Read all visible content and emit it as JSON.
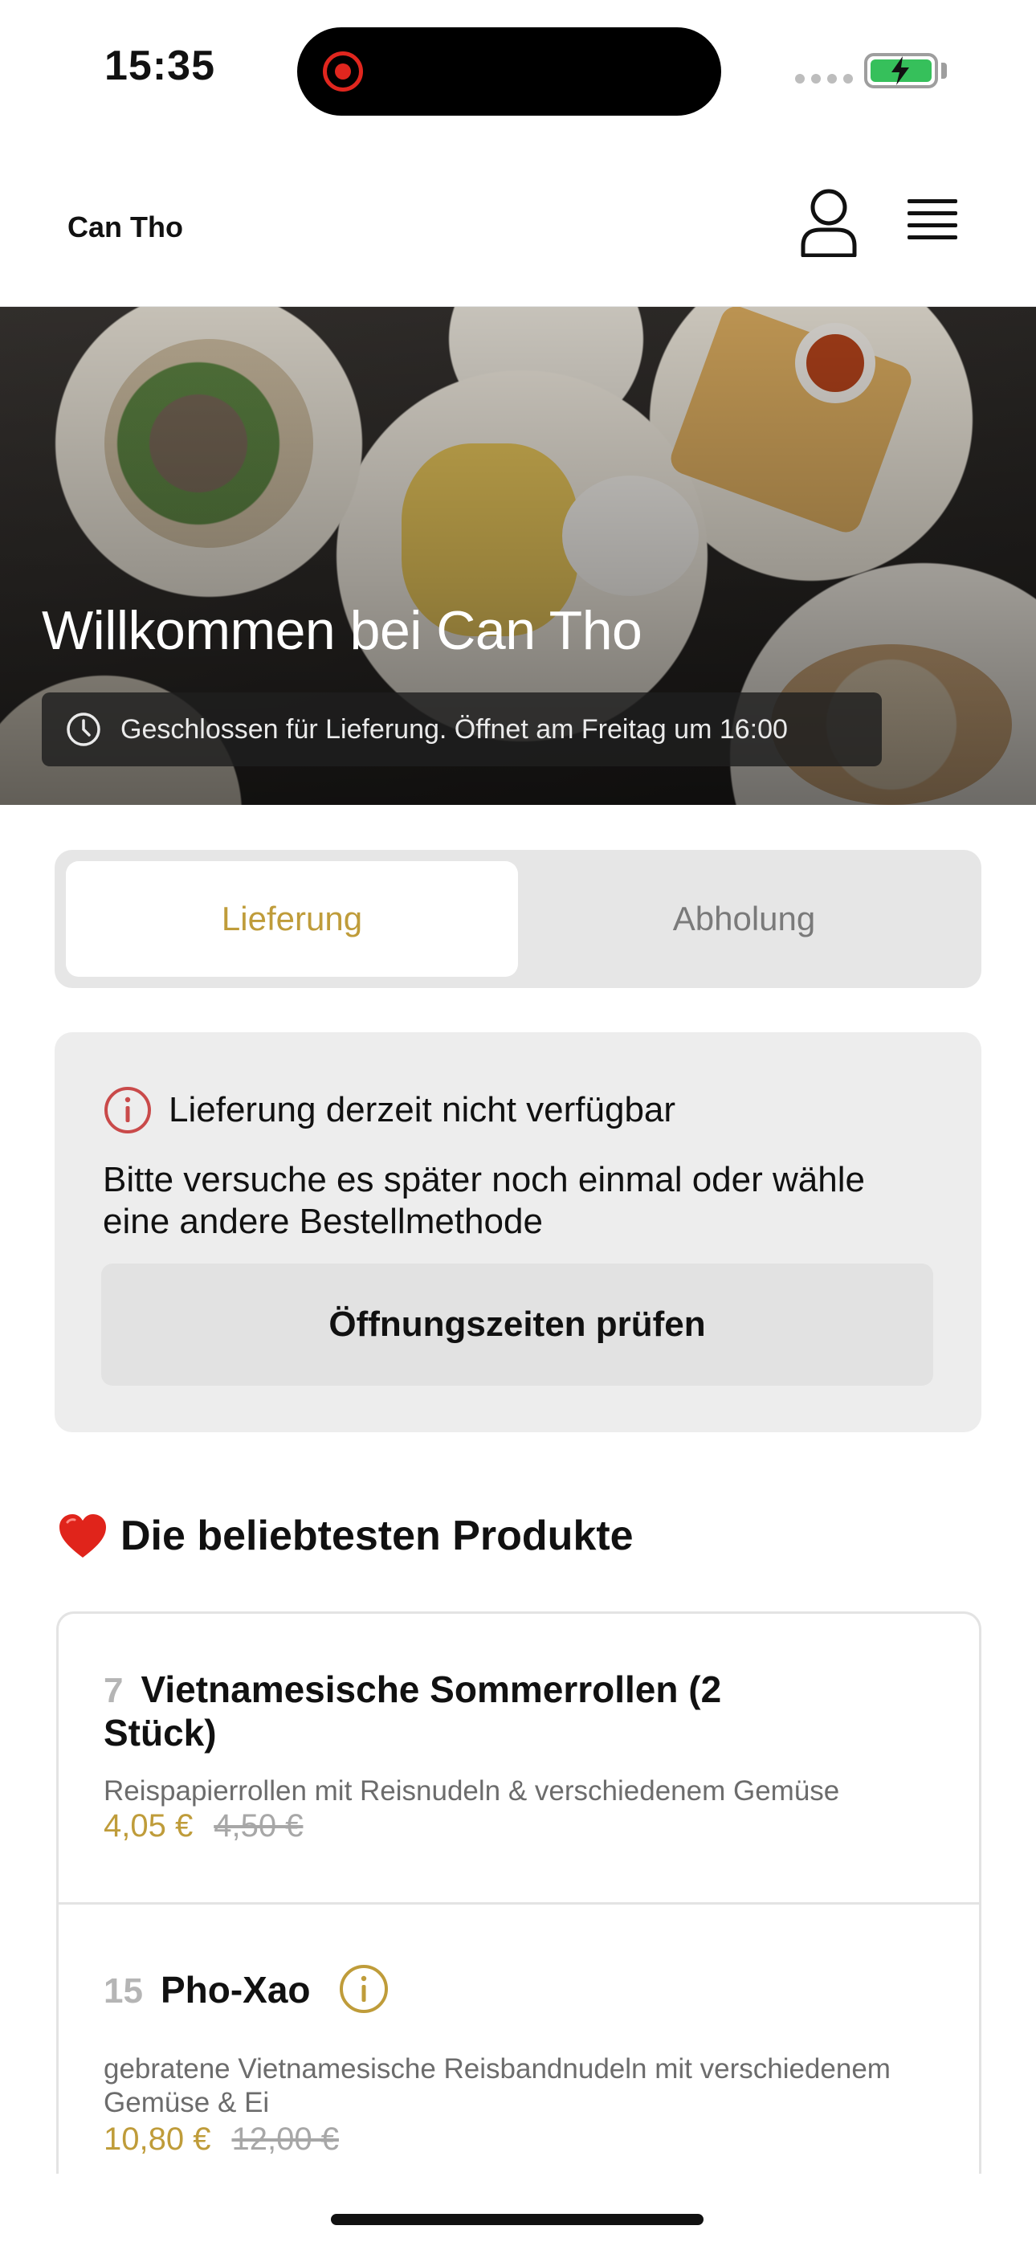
{
  "status_bar": {
    "time": "15:35"
  },
  "header": {
    "brand": "Can Tho",
    "user_icon": "user-icon",
    "menu_icon": "hamburger-menu-icon"
  },
  "hero": {
    "title": "Willkommen bei Can Tho",
    "status": "Geschlossen für Lieferung. Öffnet am Freitag um 16:00",
    "status_icon": "clock-icon"
  },
  "order_mode": {
    "options": [
      "Lieferung",
      "Abholung"
    ],
    "selected": "Lieferung"
  },
  "notice": {
    "icon": "info-circle-icon",
    "title": "Lieferung derzeit nicht verfügbar",
    "body": "Bitte versuche es später noch einmal oder wähle eine andere Bestellmethode",
    "button": "Öffnungszeiten prüfen"
  },
  "popular": {
    "icon": "heart-icon",
    "title": "Die beliebtesten Produkte",
    "items": [
      {
        "number": "7",
        "name": "Vietnamesische Sommerrollen (2 Stück)",
        "description": "Reispapierrollen mit Reisnudeln & verschiedenem Gemüse",
        "price": "4,05 €",
        "old_price": "4,50 €"
      },
      {
        "number": "15",
        "name": "Pho-Xao",
        "description": "gebratene Vietnamesische Reisbandnudeln mit verschiedenem Gemüse & Ei",
        "price": "10,80 €",
        "old_price": "12,00 €",
        "info_icon": "info-circle-icon"
      }
    ]
  },
  "colors": {
    "accent": "#bf9c3a",
    "alert": "#c94a4a"
  }
}
